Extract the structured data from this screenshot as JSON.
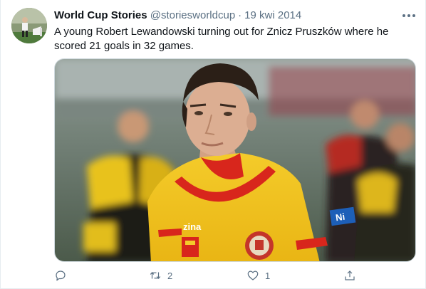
{
  "tweet": {
    "display_name": "World Cup Stories",
    "handle": "@storiesworldcup",
    "separator": "·",
    "date": "19 kwi 2014",
    "text": "A young Robert Lewandowski turning out for Znicz Pruszków where he scored 21 goals in 32 games.",
    "photo": {
      "jersey_brand": "zina",
      "sponsor": "Ni"
    }
  },
  "actions": {
    "reply_icon": "reply-icon",
    "retweet_icon": "retweet-icon",
    "retweet_count": "2",
    "like_icon": "heart-icon",
    "like_count": "1",
    "share_icon": "share-icon"
  },
  "colors": {
    "name": "#0f1419",
    "secondary": "#5b7083",
    "jersey_yellow": "#f2c21b",
    "jersey_red": "#d8261c"
  }
}
